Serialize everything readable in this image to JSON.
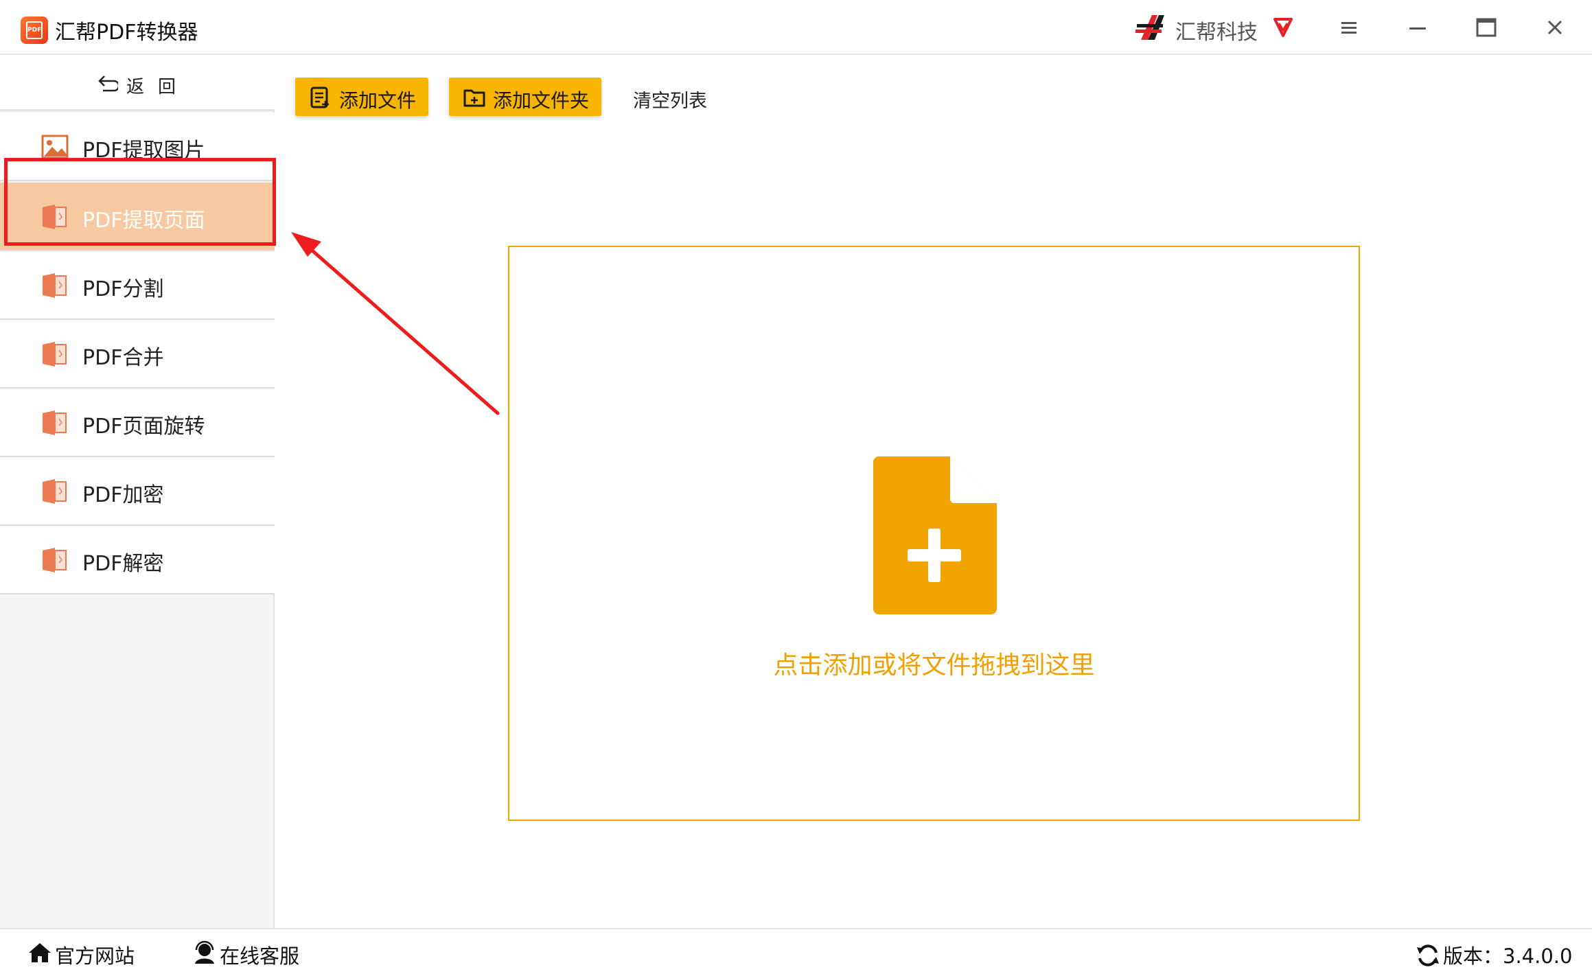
{
  "window": {
    "app_logo_text": "PDF",
    "title": "汇帮PDF转换器",
    "brand_name": "汇帮科技"
  },
  "sidebar": {
    "back_label": "返回",
    "items": [
      {
        "label": "PDF提取图片",
        "icon": "image-icon",
        "active": false
      },
      {
        "label": "PDF提取页面",
        "icon": "pdf-file-icon",
        "active": true
      },
      {
        "label": "PDF分割",
        "icon": "pdf-file-icon",
        "active": false
      },
      {
        "label": "PDF合并",
        "icon": "pdf-file-icon",
        "active": false
      },
      {
        "label": "PDF页面旋转",
        "icon": "pdf-file-icon",
        "active": false
      },
      {
        "label": "PDF加密",
        "icon": "pdf-file-icon",
        "active": false
      },
      {
        "label": "PDF解密",
        "icon": "pdf-file-icon",
        "active": false
      }
    ]
  },
  "toolbar": {
    "add_file_label": "添加文件",
    "add_folder_label": "添加文件夹",
    "clear_list_label": "清空列表"
  },
  "dropzone": {
    "hint": "点击添加或将文件拖拽到这里"
  },
  "statusbar": {
    "website_label": "官方网站",
    "support_label": "在线客服",
    "version_label": "版本：3.4.0.0"
  },
  "colors": {
    "accent": "#f7b500",
    "active_item": "#f8c9a0",
    "annotation_red": "#ee1c1c",
    "drop_border": "#f0a500"
  }
}
